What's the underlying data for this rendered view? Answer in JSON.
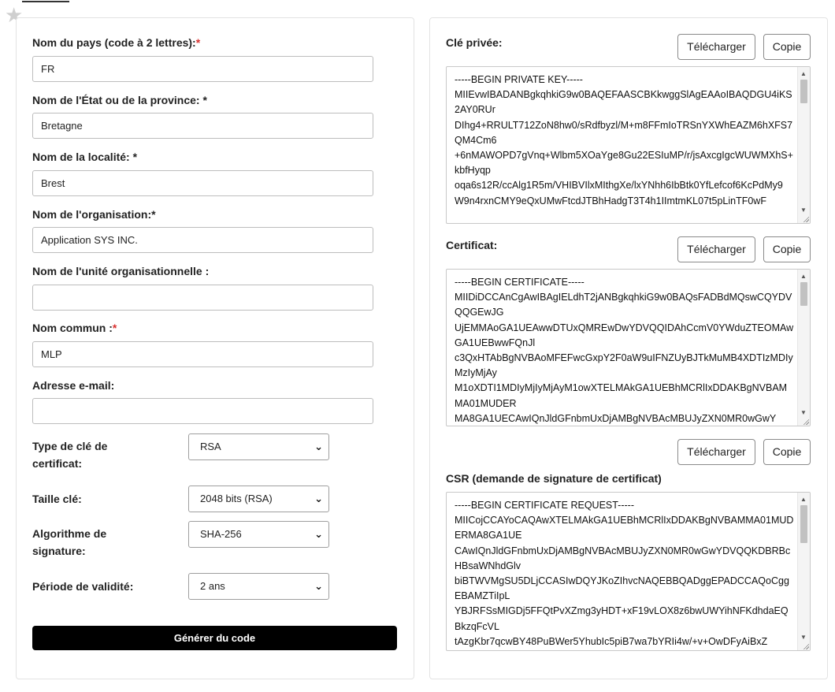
{
  "form": {
    "country": {
      "label": "Nom du pays (code à 2 lettres):",
      "required_mark": "*",
      "value": "FR"
    },
    "state": {
      "label": "Nom de l'État ou de la province: *",
      "value": "Bretagne"
    },
    "locality": {
      "label": "Nom de la localité: *",
      "value": "Brest"
    },
    "organization": {
      "label": "Nom de l'organisation:*",
      "value": "Application SYS INC."
    },
    "org_unit": {
      "label": "Nom de l'unité organisationnelle :",
      "value": ""
    },
    "common_name": {
      "label": "Nom commun :",
      "required_mark": "*",
      "value": "MLP"
    },
    "email": {
      "label": "Adresse e-mail:",
      "value": ""
    },
    "key_type": {
      "label": "Type de clé de certificat:",
      "selected": "RSA"
    },
    "key_size": {
      "label": "Taille clé:",
      "selected": "2048 bits (RSA)"
    },
    "sig_algo": {
      "label": "Algorithme de signature:",
      "selected": "SHA-256"
    },
    "validity": {
      "label": "Période de validité:",
      "selected": "2 ans"
    },
    "generate_label": "Générer du code"
  },
  "output": {
    "download_label": "Télécharger",
    "copy_label": "Copie",
    "private_key": {
      "label": "Clé privée:",
      "text": "-----BEGIN PRIVATE KEY-----\nMIIEvwIBADANBgkqhkiG9w0BAQEFAASCBKkwggSlAgEAAoIBAQDGU4iKS2AY0RUr\nDIhg4+RRULT712ZoN8hw0/sRdfbyzl/M+m8FFmIoTRSnYXWhEAZM6hXFS7QM4Cm6\n+6nMAWOPD7gVnq+Wlbm5XOaYge8Gu22ESIuMP/r/jsAxcgIgcWUWMXhS+kbfHyqp\noqa6s12R/ccAlg1R5m/VHIBVIlxMIthgXe/lxYNhh6IbBtk0YfLefcof6KcPdMy9\nW9n4rxnCMY9eQxUMwFtcdJTBhHadgT3T4h1IImtmKL07t5pLinTF0wF"
    },
    "certificate": {
      "label": "Certificat:",
      "text": "-----BEGIN CERTIFICATE-----\nMIIDiDCCAnCgAwIBAgIELdhT2jANBgkqhkiG9w0BAQsFADBdMQswCQYDVQQGEwJG\nUjEMMAoGA1UEAwwDTUxQMREwDwYDVQQIDAhCcmV0YWduZTEOMAwGA1UEBwwFQnJl\nc3QxHTAbBgNVBAoMFEFwcGxpY2F0aW9uIFNZUyBJTkMuMB4XDTIzMDIyMzIyMjAy\nM1oXDTI1MDIyMjIyMjAyM1owXTELMAkGA1UEBhMCRlIxDDAKBgNVBAMMA01MUDER\nMA8GA1UECAwIQnJldGFnbmUxDjAMBgNVBAcMBUJyZXN0MR0wGwY"
    },
    "csr": {
      "label": "CSR (demande de signature de certificat)",
      "text": "-----BEGIN CERTIFICATE REQUEST-----\nMIICojCCAYoCAQAwXTELMAkGA1UEBhMCRlIxDDAKBgNVBAMMA01MUDERMA8GA1UE\nCAwIQnJldGFnbmUxDjAMBgNVBAcMBUJyZXN0MR0wGwYDVQQKDBRBcHBsaWNhdGlv\nbiBTWVMgSU5DLjCCASIwDQYJKoZIhvcNAQEBBQADggEPADCCAQoCggEBAMZTiIpL\nYBJRFSsMIGDj5FFQtPvXZmg3yHDT+xF19vLOX8z6bwUWYihNFKdhdaEQBkzqFcVL\ntAzgKbr7qcwBY48PuBWer5YhubIc5piB7wa7bYRIi4w/+v+OwDFyAiBxZ"
    }
  }
}
